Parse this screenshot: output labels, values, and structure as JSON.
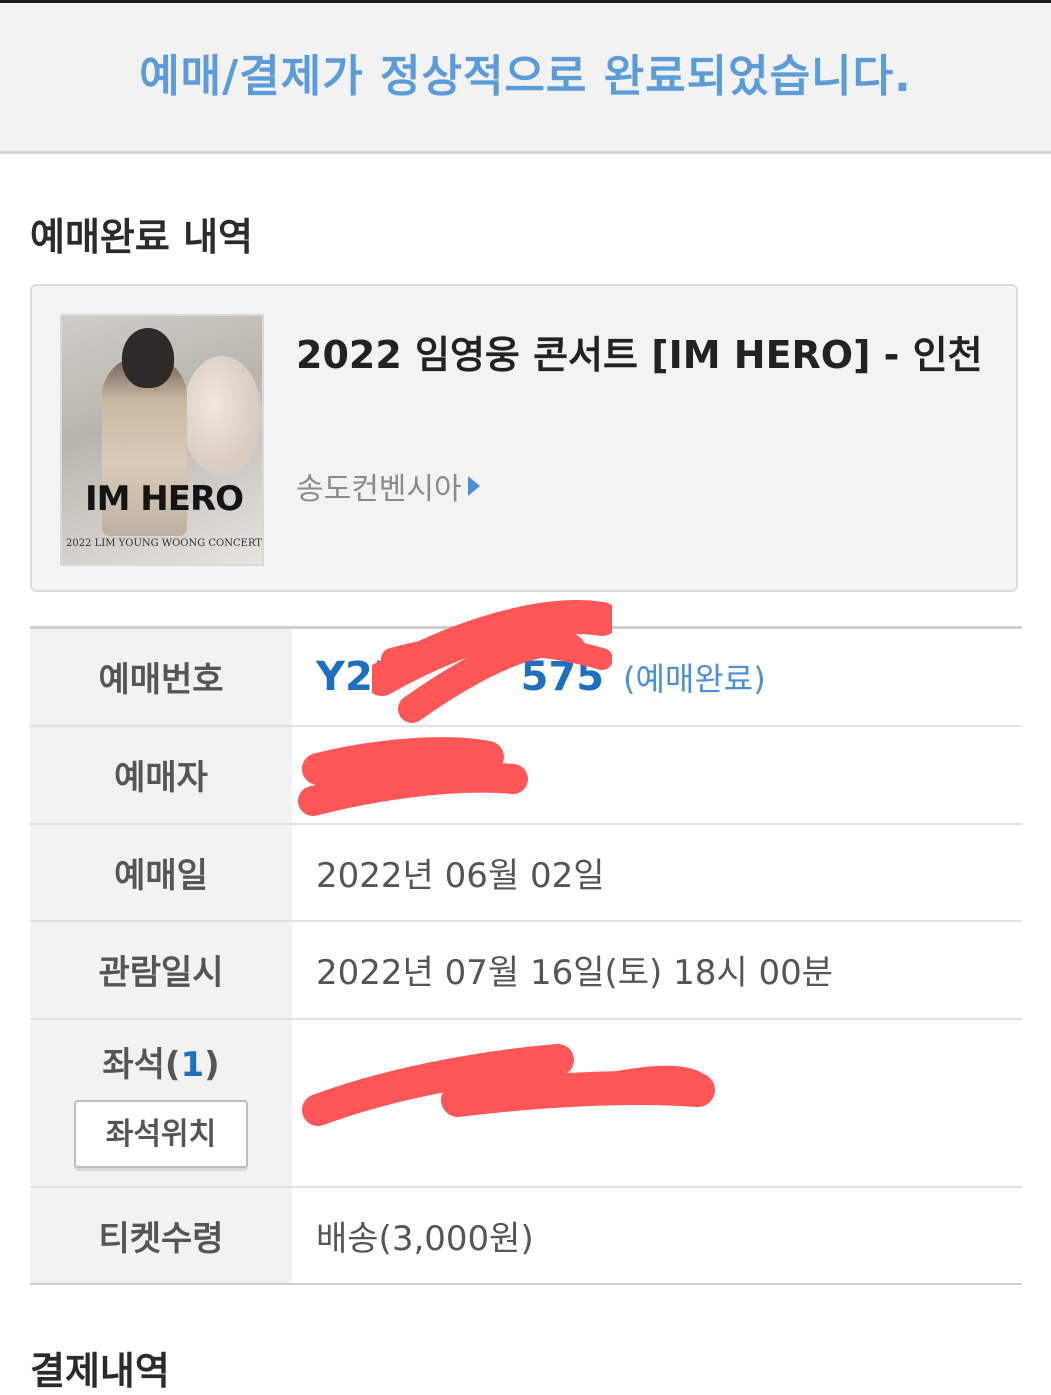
{
  "banner": {
    "message": "예매/결제가 정상적으로 완료되었습니다."
  },
  "section_title": "예매완료 내역",
  "concert": {
    "title": "2022 임영웅 콘서트 [IM HERO] - 인천",
    "venue": "송도컨벤시아",
    "poster": {
      "logo_text": "IM HERO",
      "sub_text": "2022 LIM YOUNG WOONG CONCERT"
    }
  },
  "details": {
    "reservation_number": {
      "label": "예매번호",
      "value": "Y25",
      "value_suffix": "575",
      "status": "(예매완료)"
    },
    "booker": {
      "label": "예매자",
      "value": ""
    },
    "booking_date": {
      "label": "예매일",
      "value": "2022년 06월 02일"
    },
    "viewing_datetime": {
      "label": "관람일시",
      "value": "2022년 07월 16일(토) 18시 00분"
    },
    "seats": {
      "label_prefix": "좌석(",
      "count": "1",
      "label_suffix": ")",
      "button_label": "좌석위치",
      "value": ""
    },
    "ticket_pickup": {
      "label": "티켓수령",
      "value": "배송(3,000원)"
    }
  },
  "next_section_title": "결제내역",
  "colors": {
    "accent": "#5a9bd8",
    "link": "#1f6fbf",
    "redaction": "#ff5757"
  }
}
